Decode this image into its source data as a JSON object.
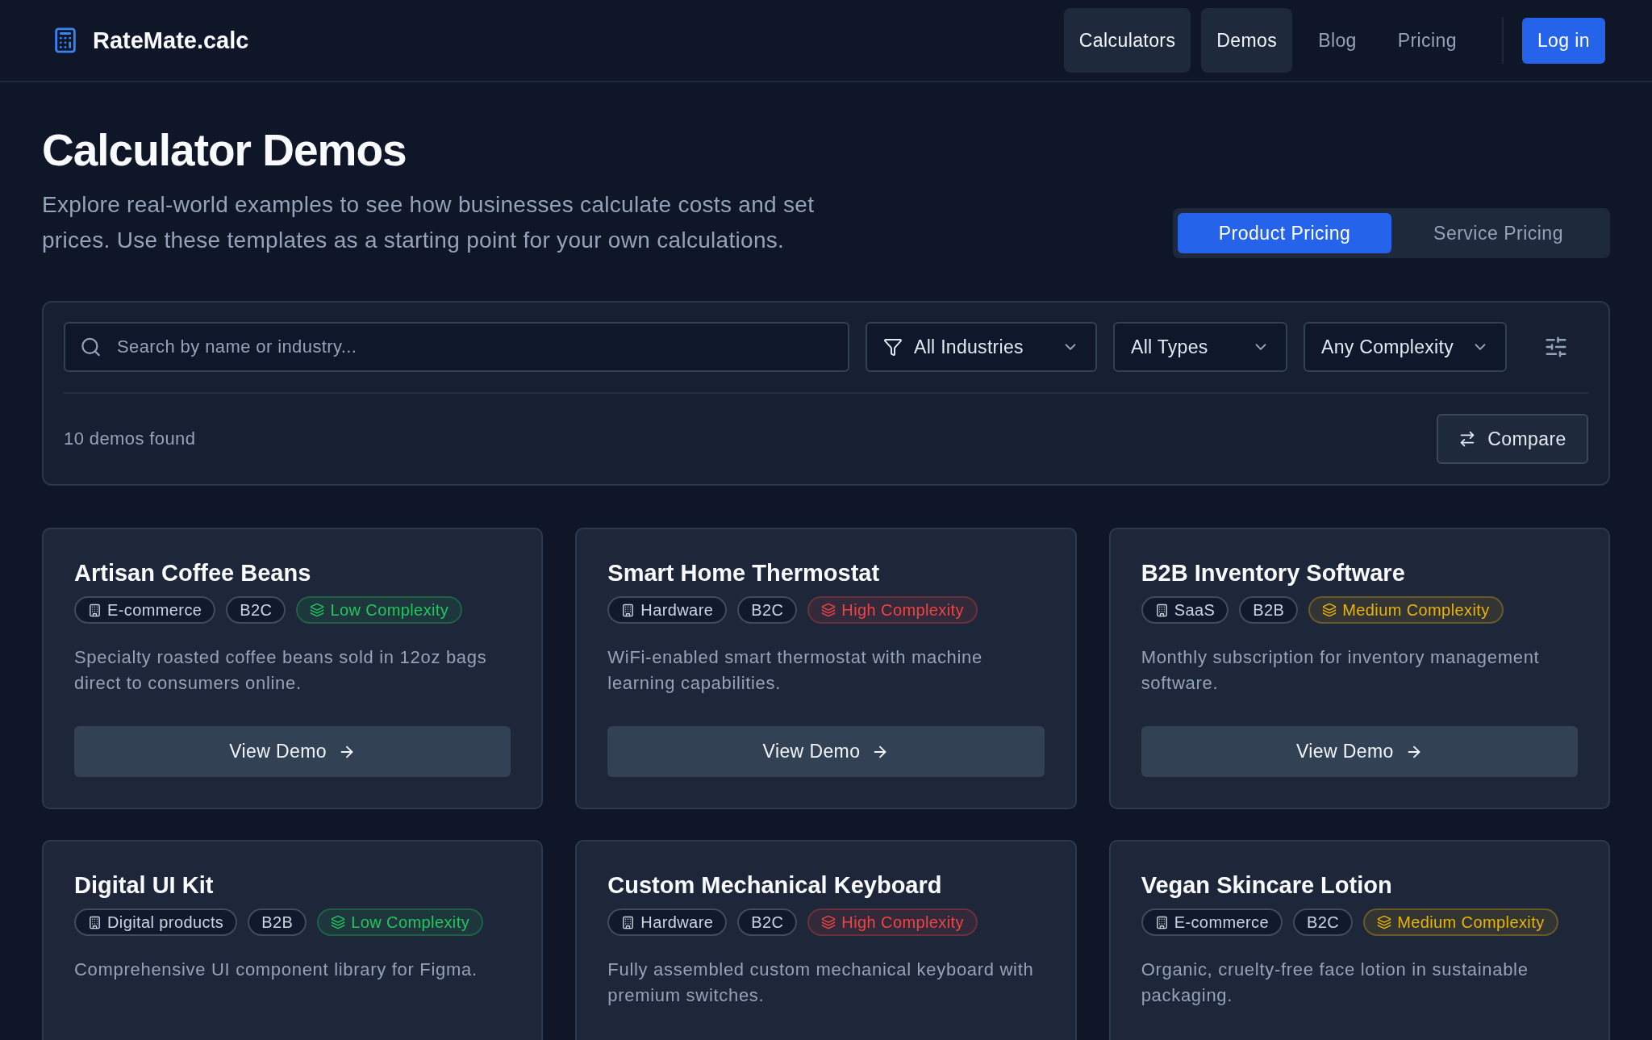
{
  "header": {
    "brand": "RateMate.calc",
    "nav": [
      {
        "label": "Calculators",
        "selected": true
      },
      {
        "label": "Demos",
        "selected": true
      },
      {
        "label": "Blog",
        "selected": false
      },
      {
        "label": "Pricing",
        "selected": false
      }
    ],
    "login": "Log in"
  },
  "hero": {
    "title": "Calculator Demos",
    "subtitle": "Explore real-world examples to see how businesses calculate costs and set prices. Use these templates as a starting point for your own calculations.",
    "tabs": [
      {
        "label": "Product Pricing",
        "selected": true
      },
      {
        "label": "Service Pricing",
        "selected": false
      }
    ]
  },
  "filters": {
    "search": {
      "placeholder": "Search by name or industry..."
    },
    "dropdowns": [
      {
        "kind": "industry",
        "label": "All Industries"
      },
      {
        "kind": "type",
        "label": "All Types"
      },
      {
        "kind": "complexity",
        "label": "Any Complexity"
      }
    ],
    "results": "10 demos found",
    "compare": "Compare"
  },
  "cards": [
    {
      "title": "Artisan Coffee Beans",
      "industry": "E-commerce",
      "model": "B2C",
      "complexity": {
        "label": "Low Complexity",
        "color": "#22c55e"
      },
      "description": "Specialty roasted coffee beans sold in 12oz bags direct to consumers online.",
      "action": "View Demo"
    },
    {
      "title": "Smart Home Thermostat",
      "industry": "Hardware",
      "model": "B2C",
      "complexity": {
        "label": "High Complexity",
        "color": "#ef4444"
      },
      "description": "WiFi-enabled smart thermostat with machine learning capabilities.",
      "action": "View Demo"
    },
    {
      "title": "B2B Inventory Software",
      "industry": "SaaS",
      "model": "B2B",
      "complexity": {
        "label": "Medium Complexity",
        "color": "#eab308"
      },
      "description": "Monthly subscription for inventory management software.",
      "action": "View Demo"
    },
    {
      "title": "Digital UI Kit",
      "industry": "Digital products",
      "model": "B2B",
      "complexity": {
        "label": "Low Complexity",
        "color": "#22c55e"
      },
      "description": "Comprehensive UI component library for Figma."
    },
    {
      "title": "Custom Mechanical Keyboard",
      "industry": "Hardware",
      "model": "B2C",
      "complexity": {
        "label": "High Complexity",
        "color": "#ef4444"
      },
      "description": "Fully assembled custom mechanical keyboard with premium switches."
    },
    {
      "title": "Vegan Skincare Lotion",
      "industry": "E-commerce",
      "model": "B2C",
      "complexity": {
        "label": "Medium Complexity",
        "color": "#eab308"
      },
      "description": "Organic, cruelty-free face lotion in sustainable packaging."
    }
  ]
}
